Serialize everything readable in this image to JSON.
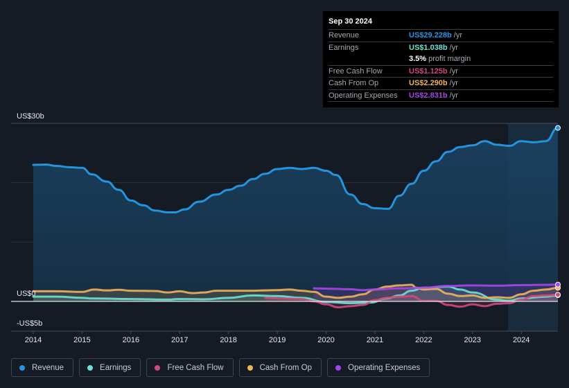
{
  "tooltip": {
    "date": "Sep 30 2024",
    "rows": [
      {
        "label": "Revenue",
        "value": "US$29.228b",
        "unit": "/yr",
        "color": "#2394df"
      },
      {
        "label": "Earnings",
        "value": "US$1.038b",
        "unit": "/yr",
        "color": "#6ce2d4"
      },
      {
        "label": "",
        "margin_pct": "3.5%",
        "margin_text": "profit margin"
      },
      {
        "label": "Free Cash Flow",
        "value": "US$1.125b",
        "unit": "/yr",
        "color": "#d1487f"
      },
      {
        "label": "Cash From Op",
        "value": "US$2.290b",
        "unit": "/yr",
        "color": "#f0b35a"
      },
      {
        "label": "Operating Expenses",
        "value": "US$2.831b",
        "unit": "/yr",
        "color": "#a546e8"
      }
    ]
  },
  "legend": [
    {
      "label": "Revenue",
      "color": "#2394df"
    },
    {
      "label": "Earnings",
      "color": "#6ce2d4"
    },
    {
      "label": "Free Cash Flow",
      "color": "#d1487f"
    },
    {
      "label": "Cash From Op",
      "color": "#f0b35a"
    },
    {
      "label": "Operating Expenses",
      "color": "#a546e8"
    }
  ],
  "chart_data": {
    "type": "area",
    "title": "",
    "xlabel": "",
    "ylabel": "",
    "y_unit": "US$ billions",
    "ylim": [
      -5,
      30
    ],
    "xlim": [
      2014,
      2024.75
    ],
    "y_tick_labels": [
      {
        "value": 30,
        "label": "US$30b"
      },
      {
        "value": 0,
        "label": "US$0"
      },
      {
        "value": -5,
        "label": "-US$5b"
      }
    ],
    "gridlines": [
      30,
      20,
      10
    ],
    "x_ticks": [
      2014,
      2015,
      2016,
      2017,
      2018,
      2019,
      2020,
      2021,
      2022,
      2023,
      2024
    ],
    "x_tick_labels": [
      "2014",
      "2015",
      "2016",
      "2017",
      "2018",
      "2019",
      "2020",
      "2021",
      "2022",
      "2023",
      "2024"
    ],
    "highlight_from": 2023.73,
    "series": [
      {
        "name": "Revenue",
        "color": "#2394df",
        "fill": true,
        "points": [
          [
            2014,
            23.0
          ],
          [
            2014.25,
            23.05
          ],
          [
            2014.5,
            22.8
          ],
          [
            2014.75,
            22.6
          ],
          [
            2015,
            22.5
          ],
          [
            2015.2,
            21.4
          ],
          [
            2015.5,
            20.2
          ],
          [
            2015.75,
            18.8
          ],
          [
            2016,
            17.0
          ],
          [
            2016.25,
            16.2
          ],
          [
            2016.5,
            15.3
          ],
          [
            2016.75,
            15.0
          ],
          [
            2016.9,
            15.0
          ],
          [
            2017.1,
            15.5
          ],
          [
            2017.4,
            16.8
          ],
          [
            2017.75,
            18.0
          ],
          [
            2018,
            18.8
          ],
          [
            2018.25,
            19.5
          ],
          [
            2018.5,
            20.6
          ],
          [
            2018.75,
            21.5
          ],
          [
            2019,
            22.3
          ],
          [
            2019.25,
            22.5
          ],
          [
            2019.5,
            22.3
          ],
          [
            2019.75,
            22.5
          ],
          [
            2020,
            22.0
          ],
          [
            2020.2,
            21.3
          ],
          [
            2020.5,
            18.0
          ],
          [
            2020.75,
            16.4
          ],
          [
            2021,
            15.7
          ],
          [
            2021.27,
            15.6
          ],
          [
            2021.5,
            17.8
          ],
          [
            2021.75,
            19.8
          ],
          [
            2022,
            22.0
          ],
          [
            2022.25,
            23.6
          ],
          [
            2022.5,
            25.2
          ],
          [
            2022.75,
            26.0
          ],
          [
            2023,
            26.3
          ],
          [
            2023.25,
            27.0
          ],
          [
            2023.5,
            26.4
          ],
          [
            2023.75,
            26.2
          ],
          [
            2024,
            27.0
          ],
          [
            2024.25,
            26.8
          ],
          [
            2024.5,
            27.0
          ],
          [
            2024.75,
            29.23
          ]
        ]
      },
      {
        "name": "Earnings",
        "color": "#6ce2d4",
        "fill": true,
        "points": [
          [
            2014,
            0.8
          ],
          [
            2014.5,
            0.8
          ],
          [
            2015,
            0.6
          ],
          [
            2015.2,
            0.5
          ],
          [
            2016,
            0.4
          ],
          [
            2016.75,
            0.3
          ],
          [
            2017,
            0.4
          ],
          [
            2017.5,
            0.35
          ],
          [
            2018,
            0.6
          ],
          [
            2018.5,
            1.0
          ],
          [
            2019,
            0.9
          ],
          [
            2019.5,
            0.6
          ],
          [
            2020,
            -0.1
          ],
          [
            2020.5,
            -0.3
          ],
          [
            2020.9,
            -0.2
          ],
          [
            2021.25,
            0.5
          ],
          [
            2021.5,
            1.0
          ],
          [
            2021.75,
            1.8
          ],
          [
            2022,
            2.3
          ],
          [
            2022.5,
            2.5
          ],
          [
            2022.75,
            2.0
          ],
          [
            2023,
            1.5
          ],
          [
            2023.5,
            0.3
          ],
          [
            2023.75,
            0.1
          ],
          [
            2024,
            0.5
          ],
          [
            2024.5,
            0.8
          ],
          [
            2024.75,
            1.04
          ]
        ]
      },
      {
        "name": "Free Cash Flow",
        "color": "#d1487f",
        "fill": true,
        "points": [
          [
            2018.75,
            0.6
          ],
          [
            2019,
            0.5
          ],
          [
            2019.5,
            0.4
          ],
          [
            2019.75,
            0.0
          ],
          [
            2020,
            -0.5
          ],
          [
            2020.25,
            -1.0
          ],
          [
            2020.5,
            -0.8
          ],
          [
            2020.75,
            -0.6
          ],
          [
            2021,
            0.2
          ],
          [
            2021.25,
            0.6
          ],
          [
            2021.5,
            0.8
          ],
          [
            2021.75,
            0.9
          ],
          [
            2022,
            0.1
          ],
          [
            2022.25,
            0.1
          ],
          [
            2022.5,
            -0.6
          ],
          [
            2022.75,
            -0.9
          ],
          [
            2023,
            -0.5
          ],
          [
            2023.25,
            -0.8
          ],
          [
            2023.5,
            -0.4
          ],
          [
            2023.75,
            -0.3
          ],
          [
            2024,
            0.3
          ],
          [
            2024.25,
            0.9
          ],
          [
            2024.5,
            1.0
          ],
          [
            2024.75,
            1.13
          ]
        ]
      },
      {
        "name": "Cash From Op",
        "color": "#f0b35a",
        "fill": true,
        "points": [
          [
            2014,
            1.7
          ],
          [
            2014.5,
            1.7
          ],
          [
            2015,
            1.6
          ],
          [
            2015.25,
            2.0
          ],
          [
            2015.5,
            1.85
          ],
          [
            2015.75,
            1.95
          ],
          [
            2016,
            1.8
          ],
          [
            2016.5,
            1.75
          ],
          [
            2016.75,
            1.5
          ],
          [
            2017,
            1.7
          ],
          [
            2017.25,
            1.4
          ],
          [
            2017.5,
            1.5
          ],
          [
            2017.75,
            1.8
          ],
          [
            2018,
            1.8
          ],
          [
            2018.5,
            1.8
          ],
          [
            2019,
            1.9
          ],
          [
            2019.25,
            2.0
          ],
          [
            2019.5,
            1.8
          ],
          [
            2019.75,
            1.6
          ],
          [
            2020,
            0.8
          ],
          [
            2020.25,
            0.6
          ],
          [
            2020.5,
            0.8
          ],
          [
            2020.75,
            1.2
          ],
          [
            2021,
            2.0
          ],
          [
            2021.25,
            2.5
          ],
          [
            2021.5,
            2.7
          ],
          [
            2021.75,
            2.8
          ],
          [
            2021.85,
            2.3
          ],
          [
            2022,
            2.0
          ],
          [
            2022.25,
            2.1
          ],
          [
            2022.5,
            1.3
          ],
          [
            2022.75,
            0.9
          ],
          [
            2023,
            1.0
          ],
          [
            2023.25,
            0.6
          ],
          [
            2023.5,
            0.7
          ],
          [
            2023.75,
            0.6
          ],
          [
            2024,
            1.2
          ],
          [
            2024.25,
            1.8
          ],
          [
            2024.5,
            2.0
          ],
          [
            2024.75,
            2.29
          ]
        ]
      },
      {
        "name": "Operating Expenses",
        "color": "#a546e8",
        "fill": true,
        "points": [
          [
            2019.75,
            2.2
          ],
          [
            2020,
            2.15
          ],
          [
            2020.5,
            2.05
          ],
          [
            2020.75,
            1.9
          ],
          [
            2021,
            2.0
          ],
          [
            2021.5,
            2.2
          ],
          [
            2022,
            2.3
          ],
          [
            2022.5,
            2.6
          ],
          [
            2023,
            2.7
          ],
          [
            2023.5,
            2.65
          ],
          [
            2024,
            2.75
          ],
          [
            2024.5,
            2.8
          ],
          [
            2024.75,
            2.83
          ]
        ]
      }
    ]
  }
}
